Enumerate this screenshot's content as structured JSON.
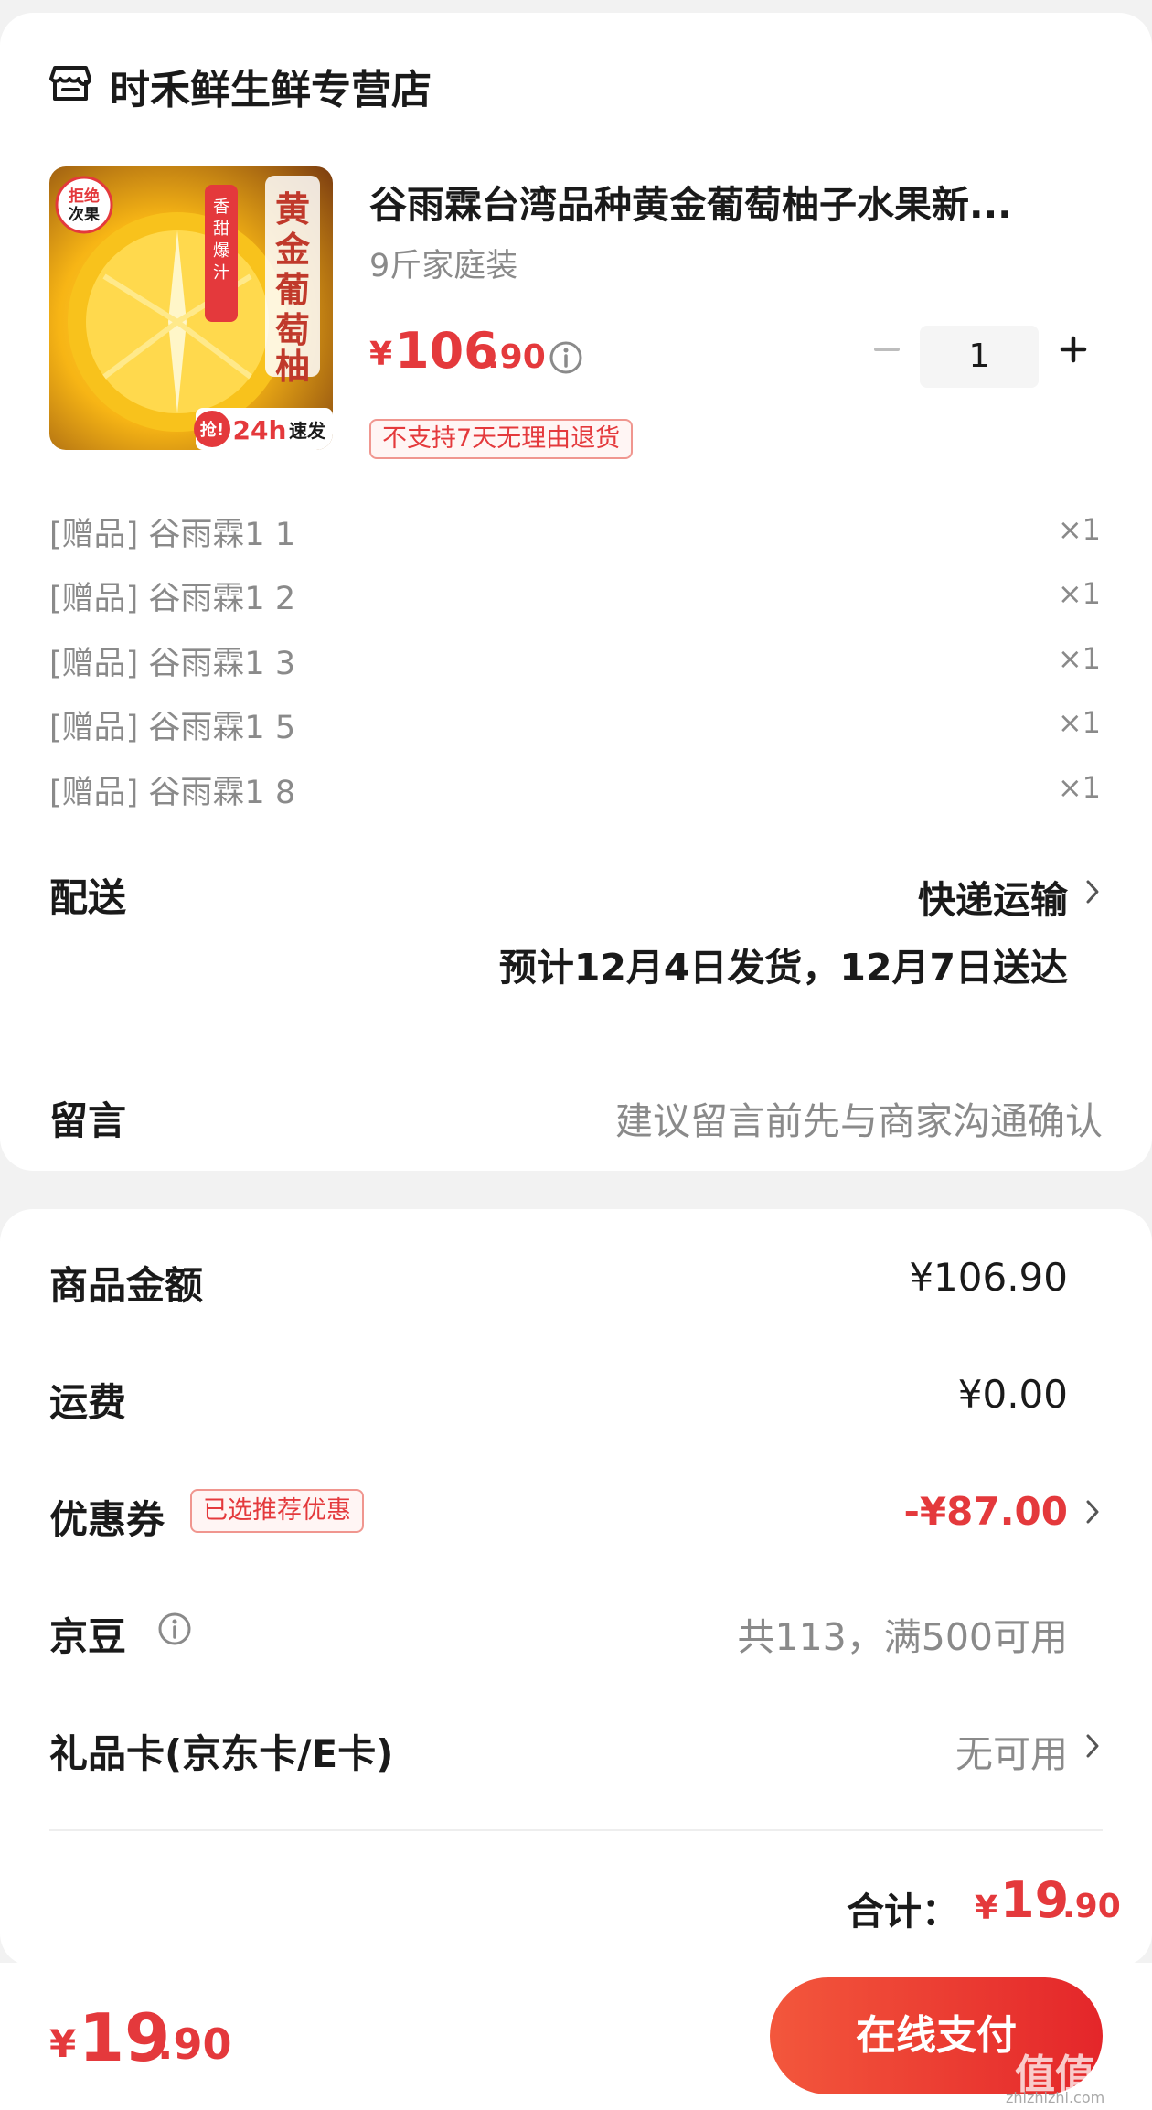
{
  "shop": {
    "name": "时禾鲜生鲜专营店",
    "icon": "store-icon"
  },
  "product": {
    "title": "谷雨霖台湾品种黄金葡萄柚子水果新...",
    "spec": "9斤家庭装",
    "price_symbol": "¥",
    "price_int": "106",
    "price_dec": ".90",
    "quantity": "1",
    "return_tag": "不支持7天无理由退货",
    "image_texts": {
      "badge": "拒绝\n次果",
      "side_label": "香甜爆汁",
      "vertical_title": "黄金葡萄柚",
      "promo": "抢!24h速发"
    }
  },
  "gifts": [
    {
      "label": "[赠品] 谷雨霖1 1",
      "qty": "×1"
    },
    {
      "label": "[赠品] 谷雨霖1 2",
      "qty": "×1"
    },
    {
      "label": "[赠品] 谷雨霖1 3",
      "qty": "×1"
    },
    {
      "label": "[赠品] 谷雨霖1 5",
      "qty": "×1"
    },
    {
      "label": "[赠品] 谷雨霖1 8",
      "qty": "×1"
    }
  ],
  "delivery": {
    "label": "配送",
    "method": "快递运输",
    "estimate": "预计12月4日发货，12月7日送达"
  },
  "remark": {
    "label": "留言",
    "placeholder": "建议留言前先与商家沟通确认"
  },
  "summary": {
    "goods_label": "商品金额",
    "goods_value": "¥106.90",
    "shipping_label": "运费",
    "shipping_value": "¥0.00",
    "coupon_label": "优惠券",
    "coupon_tag": "已选推荐优惠",
    "coupon_value": "-¥87.00",
    "jingdou_label": "京豆",
    "jingdou_value": "共113，满500可用",
    "giftcard_label": "礼品卡(京东卡/E卡)",
    "giftcard_value": "无可用",
    "total_label": "合计：",
    "total_symbol": "¥",
    "total_int": "19",
    "total_dec": ".90"
  },
  "bottom_bar": {
    "price_symbol": "¥",
    "price_int": "19",
    "price_dec": ".90",
    "pay_label": "在线支付"
  },
  "watermark": {
    "main": "值值值",
    "sub": "zhizhizhi.com"
  },
  "colors": {
    "accent": "#e4393c",
    "muted": "#8a8a8a",
    "background": "#f2f2f2"
  }
}
